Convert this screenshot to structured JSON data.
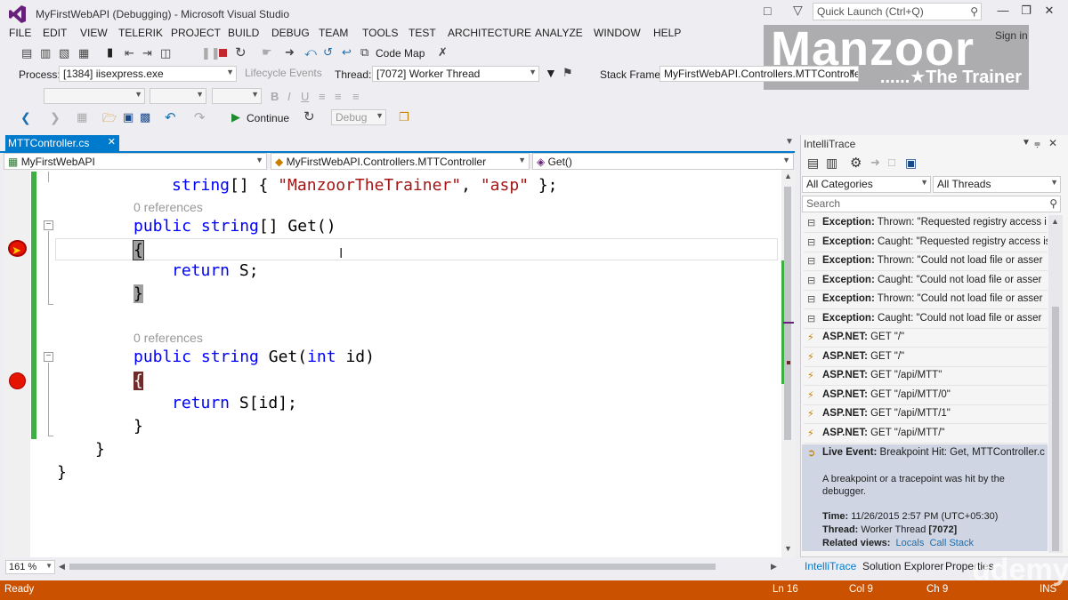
{
  "window": {
    "title": "MyFirstWebAPI (Debugging) - Microsoft Visual Studio",
    "quick_launch_placeholder": "Quick Launch (Ctrl+Q)",
    "sign_in": "Sign in"
  },
  "menu": [
    "FILE",
    "EDIT",
    "VIEW",
    "TELERIK",
    "PROJECT",
    "BUILD",
    "DEBUG",
    "TEAM",
    "TOOLS",
    "TEST",
    "ARCHITECTURE",
    "ANALYZE",
    "WINDOW",
    "HELP"
  ],
  "toolbar": {
    "code_map": "Code Map",
    "process_label": "Process:",
    "process_value": "[1384] iisexpress.exe",
    "lifecycle_events": "Lifecycle Events",
    "thread_label": "Thread:",
    "thread_value": "[7072] Worker Thread",
    "stack_frame_label": "Stack Frame:",
    "stack_frame_value": "MyFirstWebAPI.Controllers.MTTControlle",
    "continue_label": "Continue",
    "config_value": "Debug"
  },
  "watermark": {
    "name": "Manzoor",
    "tagline": "......★The Trainer",
    "brand": "udemy"
  },
  "editor": {
    "tab_name": "MTTController.cs",
    "nav_project": "MyFirstWebAPI",
    "nav_class": "MyFirstWebAPI.Controllers.MTTController",
    "nav_member": "Get()",
    "zoom": "161 %",
    "refs_label": "0 references",
    "lines": {
      "l1_kw": "string",
      "l1_rest": "[] { ",
      "l1_s1": "\"ManzoorTheTrainer\"",
      "l1_comma": ", ",
      "l1_s2": "\"asp\"",
      "l1_end": " };",
      "m1_pub": "public",
      "m1_str": "string",
      "m1_rest": "[] Get()",
      "open_brace": "{",
      "close_brace": "}",
      "ret1_kw": "return",
      "ret1_rest": " S;",
      "m2_pub": "public",
      "m2_str": "string",
      "m2_mid": " Get(",
      "m2_int": "int",
      "m2_end": " id)",
      "ret2_kw": "return",
      "ret2_rest": " S[id];"
    }
  },
  "intellitrace": {
    "title": "IntelliTrace",
    "category_filter": "All Categories",
    "thread_filter": "All Threads",
    "search_placeholder": "Search",
    "events": [
      {
        "kind": "Exception:",
        "text": " Thrown: \"Requested registry access i",
        "icon": "exception-icon"
      },
      {
        "kind": "Exception:",
        "text": " Caught: \"Requested registry access is",
        "icon": "exception-icon"
      },
      {
        "kind": "Exception:",
        "text": " Thrown: \"Could not load file or asser",
        "icon": "exception-icon"
      },
      {
        "kind": "Exception:",
        "text": " Caught: \"Could not load file or asser",
        "icon": "exception-icon"
      },
      {
        "kind": "Exception:",
        "text": " Thrown: \"Could not load file or asser",
        "icon": "exception-icon"
      },
      {
        "kind": "Exception:",
        "text": " Caught: \"Could not load file or asser",
        "icon": "exception-icon"
      },
      {
        "kind": "ASP.NET:",
        "text": " GET \"/\"",
        "icon": "lightning-icon"
      },
      {
        "kind": "ASP.NET:",
        "text": " GET \"/\"",
        "icon": "lightning-icon"
      },
      {
        "kind": "ASP.NET:",
        "text": " GET \"/api/MTT\"",
        "icon": "lightning-icon"
      },
      {
        "kind": "ASP.NET:",
        "text": " GET \"/api/MTT/0\"",
        "icon": "lightning-icon"
      },
      {
        "kind": "ASP.NET:",
        "text": " GET \"/api/MTT/1\"",
        "icon": "lightning-icon"
      },
      {
        "kind": "ASP.NET:",
        "text": " GET \"/api/MTT/\"",
        "icon": "lightning-icon"
      }
    ],
    "live_event": {
      "kind": "Live Event:",
      "text": " Breakpoint Hit: Get, MTTController.c",
      "description": "A breakpoint or a tracepoint was hit by the debugger.",
      "time_label": "Time:",
      "time_value": "11/26/2015 2:57 PM (UTC+05:30)",
      "thread_label": "Thread:",
      "thread_value": "Worker Thread ",
      "thread_id": "[7072]",
      "related_label": "Related views:",
      "link_locals": "Locals",
      "link_callstack": "Call Stack"
    },
    "tabs": [
      "IntelliTrace",
      "Solution Explorer",
      "Properties"
    ]
  },
  "status": {
    "text": "Ready",
    "line": "Ln 16",
    "col": "Col 9",
    "ch": "Ch 9",
    "mode": "INS"
  },
  "colors": {
    "accent": "#007acc",
    "status_bar": "#ca5100",
    "keyword": "#0000ff",
    "string": "#a31515",
    "breakpoint": "#e51400"
  }
}
